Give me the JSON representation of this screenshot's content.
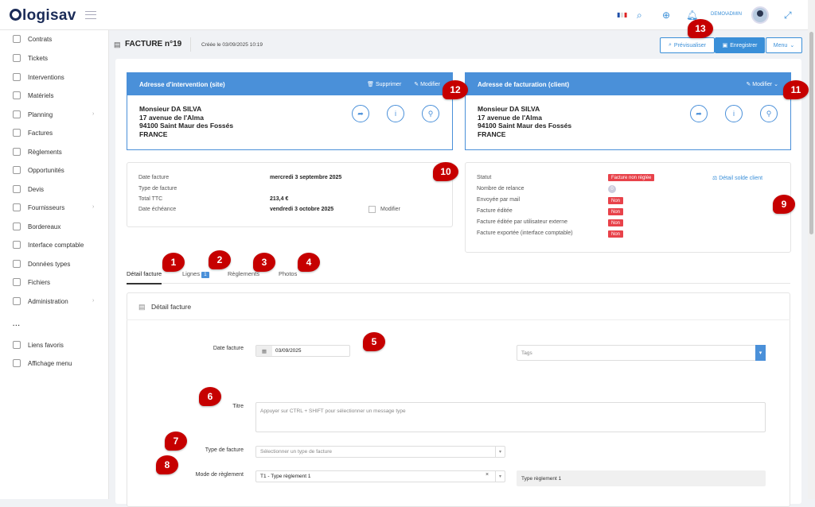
{
  "app": {
    "logo": "logisav",
    "user": "DEMO\\ADMIN"
  },
  "sidebar": {
    "items": [
      {
        "label": "Contrats"
      },
      {
        "label": "Tickets"
      },
      {
        "label": "Interventions"
      },
      {
        "label": "Matériels"
      },
      {
        "label": "Planning"
      },
      {
        "label": "Factures"
      },
      {
        "label": "Règlements"
      },
      {
        "label": "Opportunités"
      },
      {
        "label": "Devis"
      },
      {
        "label": "Fournisseurs"
      },
      {
        "label": "Bordereaux"
      },
      {
        "label": "Interface comptable"
      },
      {
        "label": "Données types"
      },
      {
        "label": "Fichiers"
      },
      {
        "label": "Administration"
      }
    ],
    "more": "...",
    "bottom": [
      {
        "label": "Liens favoris"
      },
      {
        "label": "Affichage menu"
      }
    ]
  },
  "header": {
    "title": "FACTURE n°19",
    "created": "Créée le 03/09/2025 10:19",
    "preview": "Prévisualiser",
    "save": "Enregistrer",
    "menu": "Menu"
  },
  "site_address": {
    "heading": "Adresse d'intervention (site)",
    "delete": "Supprimer",
    "edit": "Modifier",
    "lines": [
      "Monsieur DA SILVA",
      "17 avenue de l'Alma",
      "94100 Saint Maur des Fossés",
      "FRANCE"
    ]
  },
  "billing_address": {
    "heading": "Adresse de facturation (client)",
    "edit": "Modifier",
    "lines": [
      "Monsieur DA SILVA",
      "17 avenue de l'Alma",
      "94100 Saint Maur des Fossés",
      "FRANCE"
    ]
  },
  "invoice_info": {
    "date_label": "Date facture",
    "date_value": "mercredi 3 septembre 2025",
    "type_label": "Type de facture",
    "total_label": "Total TTC",
    "total_value": "213,4 €",
    "due_label": "Date échéance",
    "due_value": "vendredi 3 octobre 2025",
    "edit": "Modifier"
  },
  "status_info": {
    "status_label": "Statut",
    "status_value": "Facture non réglée",
    "balance_link": "Détail solde client",
    "reminders_label": "Nombre de relance",
    "reminders_value": "0",
    "rows": [
      {
        "label": "Envoyée par mail",
        "value": "Non"
      },
      {
        "label": "Facture éditée",
        "value": "Non"
      },
      {
        "label": "Facture éditée par utilisateur externe",
        "value": "Non"
      },
      {
        "label": "Facture exportée (interface comptable)",
        "value": "Non"
      }
    ]
  },
  "tabs": {
    "detail": "Détail facture",
    "lines": "Lignes",
    "lines_count": "1",
    "payments": "Règlements",
    "photos": "Photos"
  },
  "form": {
    "section_title": "Détail facture",
    "date_label": "Date facture",
    "date_value": "03/09/2025",
    "tags_placeholder": "Tags",
    "title_label": "Titre",
    "title_placeholder": "Appuyer sur CTRL + SHIFT pour sélectionner un message type",
    "type_label": "Type de facture",
    "type_placeholder": "Sélectionner un type de facture",
    "payment_label": "Mode de règlement",
    "payment_value": "T1 - Type règlement 1",
    "payment_side": "Type règlement 1"
  },
  "markers": [
    "1",
    "2",
    "3",
    "4",
    "5",
    "6",
    "7",
    "8",
    "9",
    "10",
    "11",
    "12",
    "13"
  ],
  "colors": {
    "accent": "#4a90d9",
    "danger": "#e8424a",
    "marker": "#c60000",
    "brand": "#1a2b57"
  }
}
